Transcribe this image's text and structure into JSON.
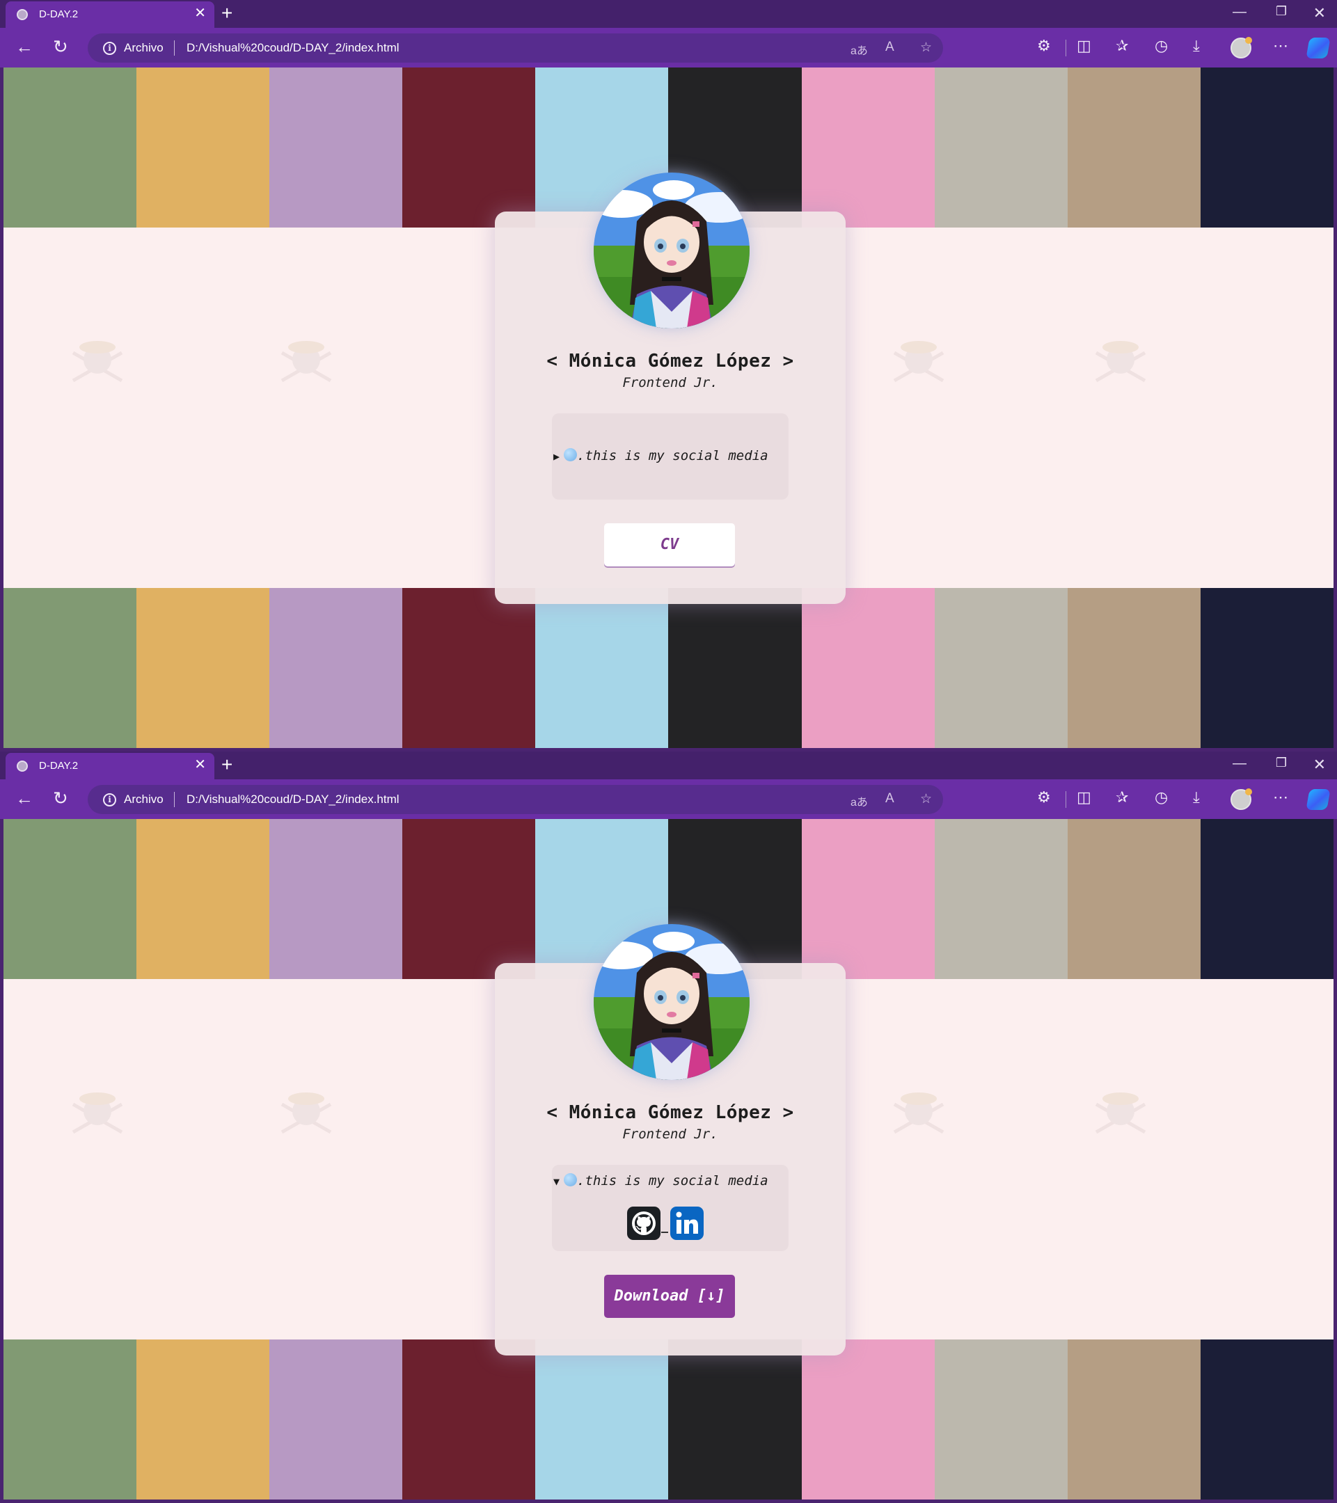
{
  "browser": {
    "tab_title": "D-DAY.2",
    "tab_close": "✕",
    "new_tab": "+",
    "minimize": "—",
    "maximize": "❐",
    "close": "✕",
    "back": "←",
    "reload": "↻",
    "info_icon": "i",
    "scheme_label": "Archivo",
    "url": "D:/Vishual%20coud/D-DAY_2/index.html",
    "tools": [
      "aあ",
      "A",
      "☆",
      "⚙",
      "◫",
      "✰",
      "◷",
      "⤓",
      "⋯"
    ]
  },
  "palette": [
    "#819a73",
    "#e0b162",
    "#b799c3",
    "#6c202e",
    "#a6d6e8",
    "#232325",
    "#eb9fc3",
    "#bcb8ad",
    "#b59e84",
    "#1b1e37"
  ],
  "profile": {
    "name": "< Mónica Gómez López >",
    "role": "Frontend Jr."
  },
  "state_collapsed": {
    "summary_caret": "▶",
    "summary_text": ".this is my social media",
    "button_label": "CV"
  },
  "state_expanded": {
    "summary_caret": "▼",
    "summary_text": ".this is my social media",
    "button_label": "Download [↓]",
    "social_icons": [
      "github-icon",
      "linkedin-icon"
    ]
  },
  "colors": {
    "browser_frame": "#6a2ea6",
    "card_bg": "#f0e4e6",
    "button_dark": "#8a3a99",
    "button_text_light": "#7d3b8d"
  }
}
